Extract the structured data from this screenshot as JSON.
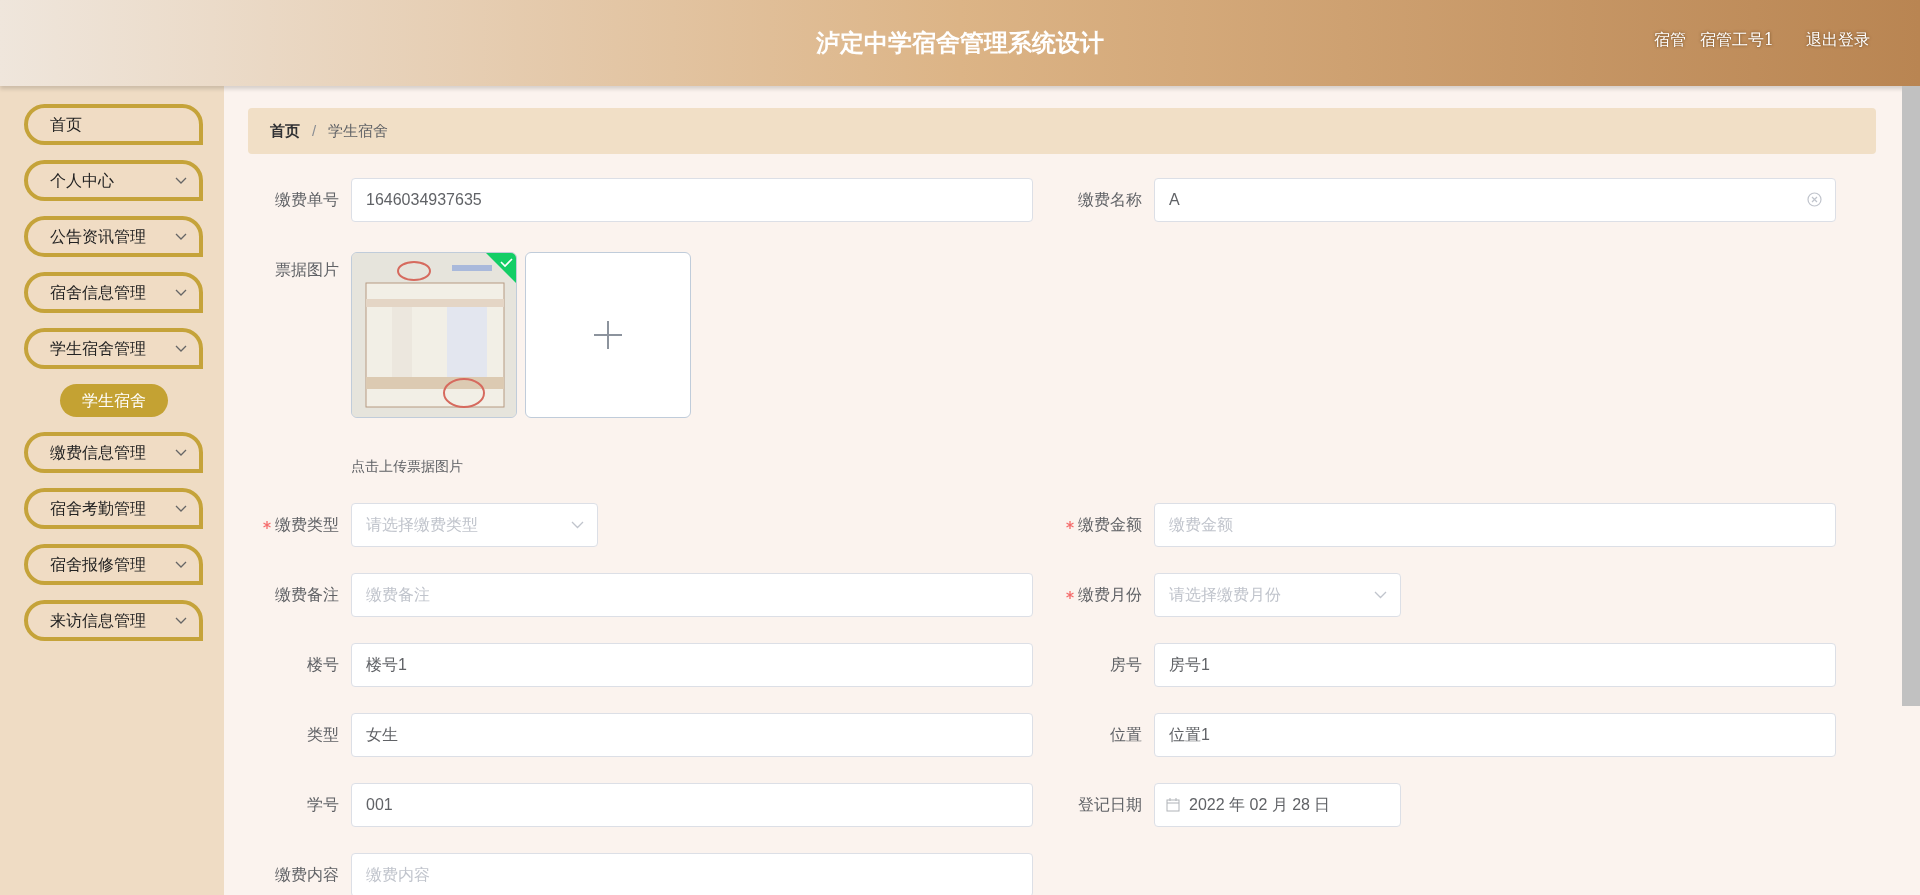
{
  "header": {
    "title": "泸定中学宿舍管理系统设计",
    "role": "宿管",
    "user": "宿管工号1",
    "logout": "退出登录"
  },
  "sidebar": {
    "items": [
      {
        "label": "首页",
        "kind": "link"
      },
      {
        "label": "个人中心",
        "kind": "submenu"
      },
      {
        "label": "公告资讯管理",
        "kind": "submenu"
      },
      {
        "label": "宿舍信息管理",
        "kind": "submenu"
      },
      {
        "label": "学生宿舍管理",
        "kind": "submenu",
        "children": [
          {
            "label": "学生宿舍",
            "selected": true
          }
        ]
      },
      {
        "label": "缴费信息管理",
        "kind": "submenu"
      },
      {
        "label": "宿舍考勤管理",
        "kind": "submenu"
      },
      {
        "label": "宿舍报修管理",
        "kind": "submenu"
      },
      {
        "label": "来访信息管理",
        "kind": "submenu"
      }
    ]
  },
  "breadcrumb": {
    "items": [
      "首页",
      "学生宿舍"
    ],
    "separator": "/"
  },
  "form": {
    "fields": [
      {
        "kind": "text",
        "label": "缴费单号",
        "value": "1646034937635",
        "required": false
      },
      {
        "kind": "text",
        "label": "缴费名称",
        "value": "A",
        "required": false,
        "clearable": true
      },
      {
        "kind": "upload",
        "label": "票据图片",
        "uploaded": true,
        "hint": "点击上传票据图片"
      },
      {
        "kind": "select",
        "label": "缴费类型",
        "placeholder": "请选择缴费类型",
        "required": true
      },
      {
        "kind": "text",
        "label": "缴费金额",
        "placeholder": "缴费金额",
        "required": true
      },
      {
        "kind": "text",
        "label": "缴费备注",
        "placeholder": "缴费备注",
        "required": false
      },
      {
        "kind": "select",
        "label": "缴费月份",
        "placeholder": "请选择缴费月份",
        "required": true
      },
      {
        "kind": "text",
        "label": "楼号",
        "value": "楼号1",
        "required": false
      },
      {
        "kind": "text",
        "label": "房号",
        "value": "房号1",
        "required": false
      },
      {
        "kind": "text",
        "label": "类型",
        "value": "女生",
        "required": false
      },
      {
        "kind": "text",
        "label": "位置",
        "value": "位置1",
        "required": false
      },
      {
        "kind": "text",
        "label": "学号",
        "value": "001",
        "required": false
      },
      {
        "kind": "date",
        "label": "登记日期",
        "value": "2022 年 02 月 28 日",
        "required": false
      },
      {
        "kind": "text",
        "label": "缴费内容",
        "placeholder": "缴费内容",
        "required": false
      }
    ]
  }
}
